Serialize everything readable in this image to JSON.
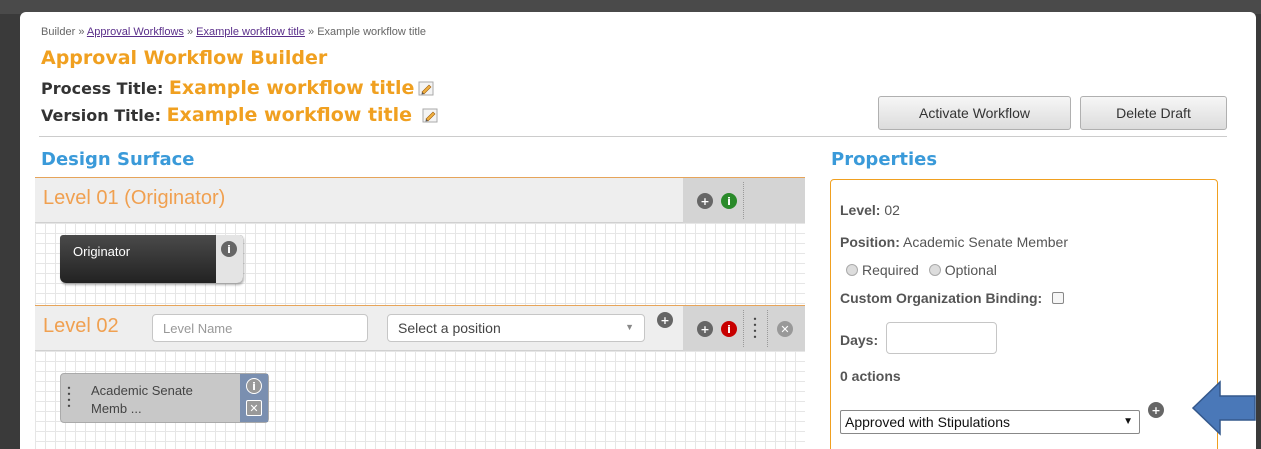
{
  "breadcrumb": {
    "root": "Builder",
    "sep": "»",
    "link1": "Approval Workflows",
    "link2": "Example workflow title",
    "current": "Example workflow title"
  },
  "page_title": "Approval Workflow Builder",
  "process": {
    "label": "Process Title:",
    "value": "Example workflow title"
  },
  "version": {
    "label": "Version Title:",
    "value": "Example workflow title"
  },
  "buttons": {
    "activate": "Activate Workflow",
    "delete": "Delete Draft"
  },
  "design_surface": {
    "title": "Design Surface",
    "level1": {
      "name": "Level 01 (Originator)",
      "card": "Originator"
    },
    "level2": {
      "name": "Level 02",
      "name_placeholder": "Level Name",
      "position_select": "Select a position",
      "card_line1": "Academic Senate",
      "card_line2": "Memb ..."
    }
  },
  "properties": {
    "title": "Properties",
    "level_label": "Level:",
    "level_value": "02",
    "position_label": "Position:",
    "position_value": "Academic Senate Member",
    "required": "Required",
    "optional": "Optional",
    "custom_binding": "Custom Organization Binding:",
    "days_label": "Days:",
    "actions": "0 actions",
    "action_select": "Approved with Stipulations"
  },
  "icons": {
    "add": "plus-circle-icon",
    "info": "info-circle-icon",
    "drag": "drag-handle-icon",
    "close": "close-circle-icon",
    "edit": "pencil-icon",
    "arrow": "blue-arrow-icon"
  },
  "colors": {
    "accent": "#f0a020",
    "section": "#3a9ad9",
    "info_green": "#2a8a2a",
    "info_red": "#c80000",
    "arrow": "#4a78b8"
  }
}
